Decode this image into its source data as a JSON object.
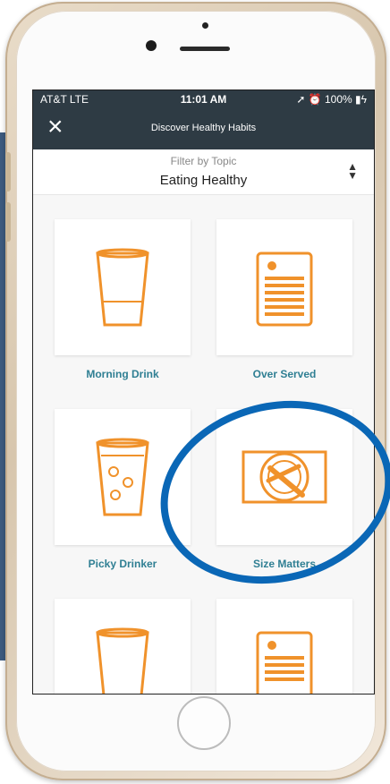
{
  "status_bar": {
    "carrier": "AT&T  LTE",
    "time": "11:01 AM",
    "right": "➚ ⏰ 100% ▮ϟ"
  },
  "header": {
    "close_icon": "×",
    "title": "Discover Healthy Habits"
  },
  "filter": {
    "label": "Filter by Topic",
    "value": "Eating Healthy",
    "icon": "sort-icon"
  },
  "cards": [
    {
      "label": "Morning Drink",
      "icon": "cup-icon"
    },
    {
      "label": "Over Served",
      "icon": "menu-icon"
    },
    {
      "label": "Picky Drinker",
      "icon": "bubbly-cup-icon"
    },
    {
      "label": "Size Matters",
      "icon": "plate-icon"
    },
    {
      "label": "",
      "icon": "cup-icon"
    },
    {
      "label": "",
      "icon": "menu-icon"
    }
  ],
  "colors": {
    "header": "#2e3b44",
    "icon_orange": "#f0922b",
    "label_teal": "#2f7f93",
    "highlight_circle": "#0a67b6"
  }
}
